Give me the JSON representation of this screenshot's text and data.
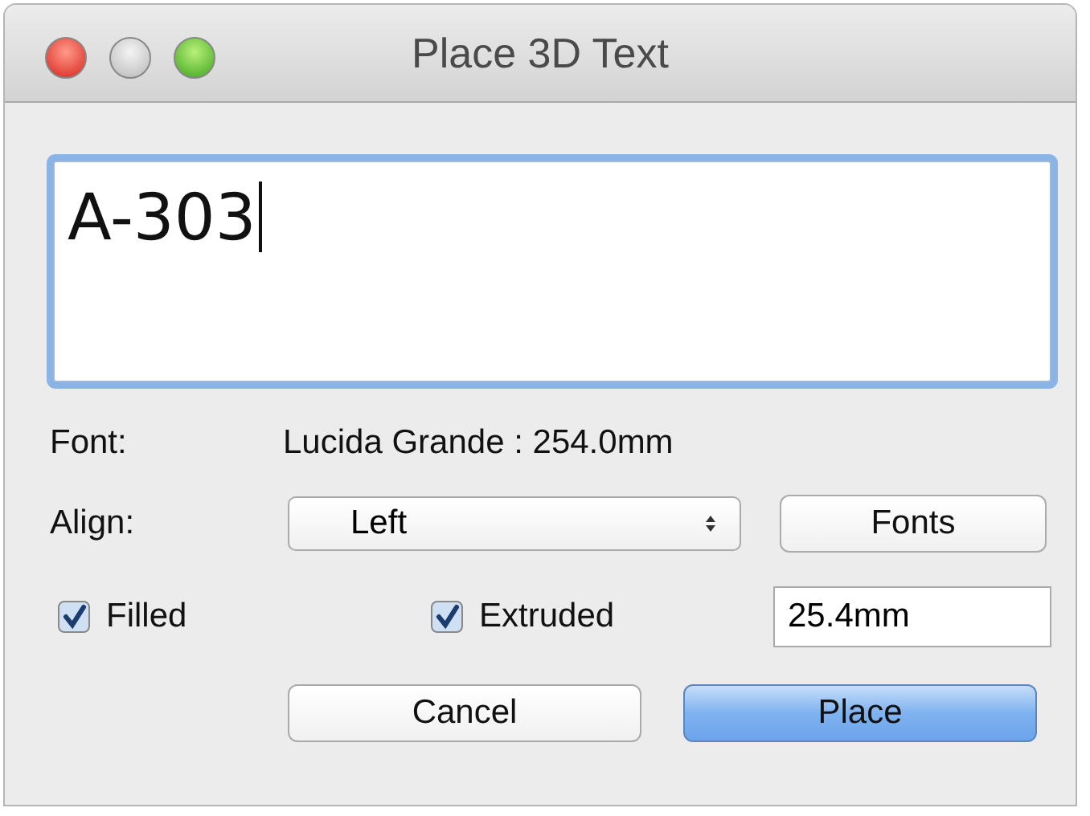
{
  "window": {
    "title": "Place 3D Text"
  },
  "text_area": {
    "value": "A-303"
  },
  "font": {
    "label": "Font:",
    "value": "Lucida Grande : 254.0mm"
  },
  "align": {
    "label": "Align:",
    "value": "Left"
  },
  "fonts_button": {
    "label": "Fonts"
  },
  "checkboxes": [
    {
      "label": "Filled",
      "checked": true
    },
    {
      "label": "Extruded",
      "checked": true
    }
  ],
  "extrude_depth": {
    "value": "25.4mm"
  },
  "buttons": [
    {
      "label": "Cancel",
      "default": false
    },
    {
      "label": "Place",
      "default": true
    }
  ]
}
